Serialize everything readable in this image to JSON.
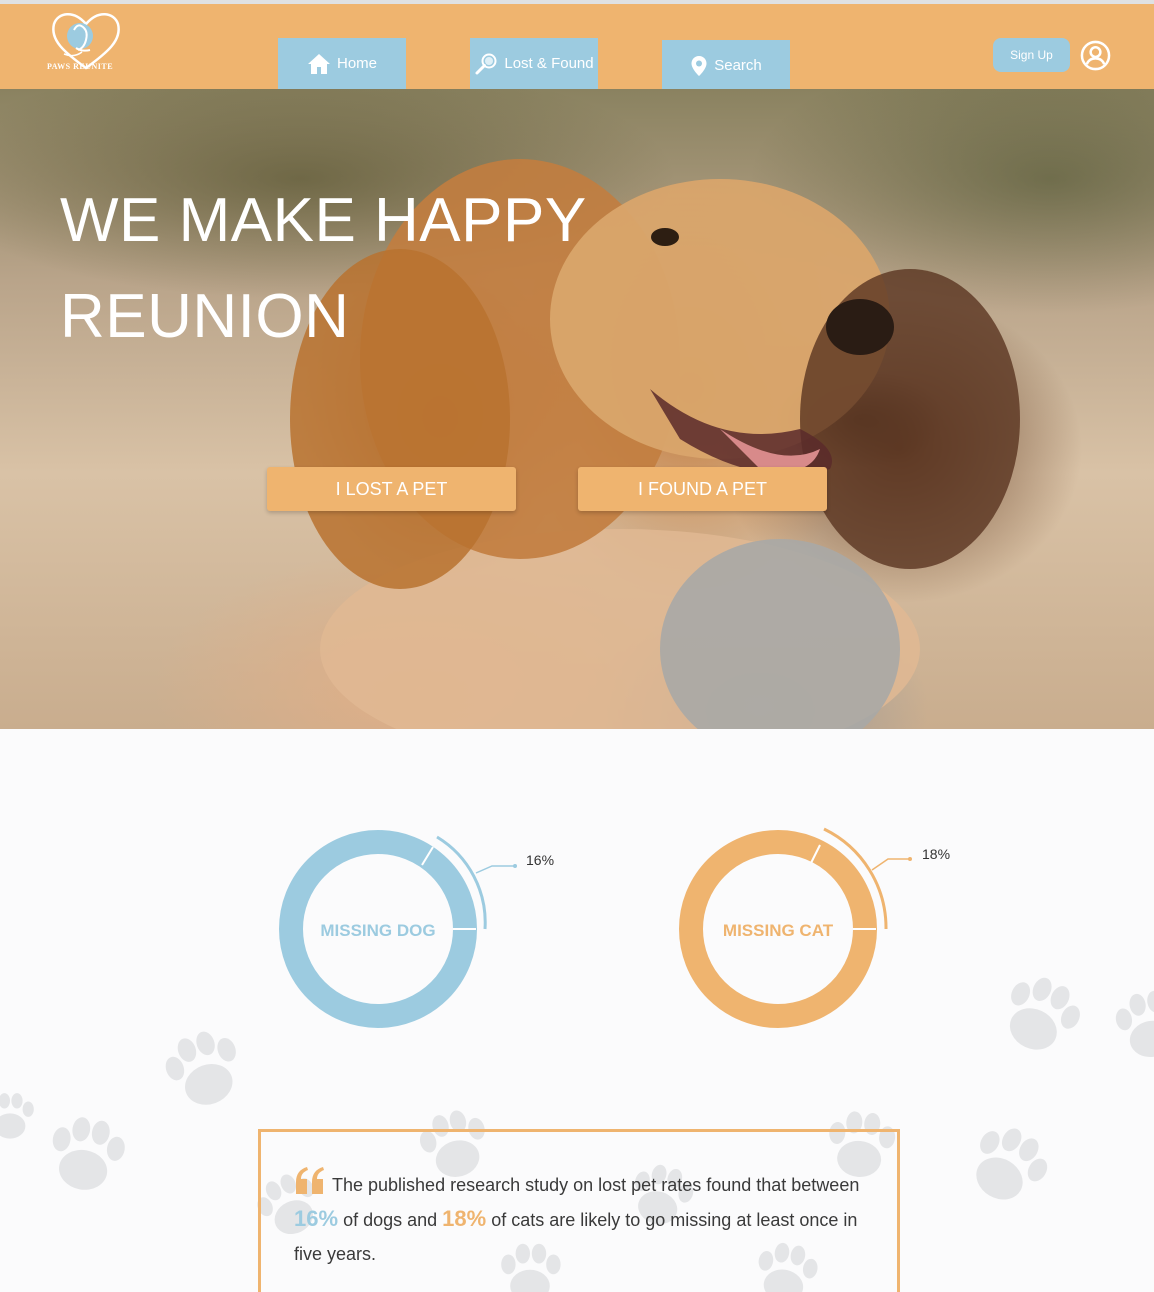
{
  "header": {
    "logo_text": "PAWS REUNITE",
    "nav": [
      {
        "label": "Home",
        "icon": "home-icon"
      },
      {
        "label": "Lost & Found",
        "icon": "magnifier-icon"
      },
      {
        "label": "Search",
        "icon": "location-pin-icon"
      }
    ],
    "signup_label": "Sign Up",
    "user_icon": "user-circle-icon"
  },
  "hero": {
    "title_line1": "WE MAKE HAPPY",
    "title_line2": "REUNION",
    "lost_button": "I LOST A PET",
    "found_button": "I FOUND A PET"
  },
  "stats": {
    "dog": {
      "label": "MISSING DOG",
      "percent_label": "16%",
      "percent": 16,
      "color": "#9ccbe0"
    },
    "cat": {
      "label": "MISSING CAT",
      "percent_label": "18%",
      "percent": 18,
      "color": "#efb46f"
    }
  },
  "quote": {
    "part1": "The published research study on lost pet rates found that between",
    "dog_pct": "16%",
    "part2": "of dogs and",
    "cat_pct": "18%",
    "part3": "of cats are likely to go missing at least once in five years."
  },
  "colors": {
    "orange": "#efb46f",
    "blue": "#9ccbe0",
    "paw": "#e3e4e6"
  }
}
